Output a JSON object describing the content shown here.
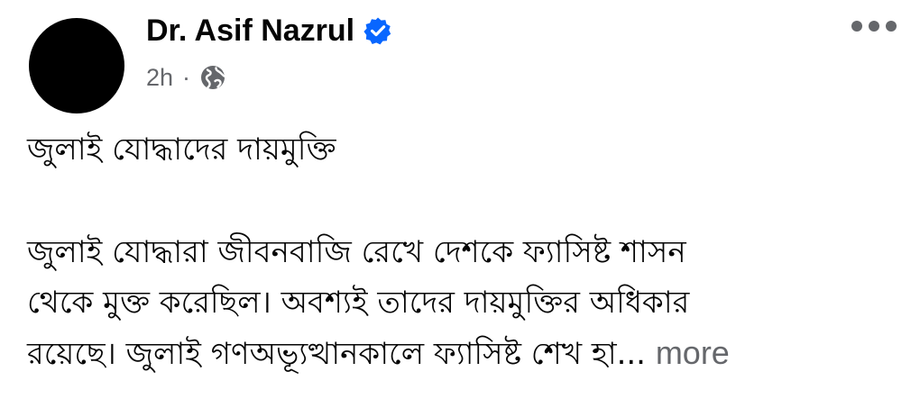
{
  "post": {
    "author_name": "Dr. Asif Nazrul",
    "verified": true,
    "timestamp": "2h",
    "separator": "·",
    "audience_icon": "globe-icon",
    "title": "জুলাই যোদ্ধাদের দায়মুক্তি",
    "body_lines": [
      "জুলাই যোদ্ধারা জীবনবাজি রেখে দেশকে ফ্যাসিষ্ট শাসন",
      "থেকে মুক্ত করেছিল। অবশ্যই তাদের দায়মুক্তির অধিকার",
      "রয়েছে। জুলাই গণঅভ্যূত্থানকালে ফ্যাসিষ্ট শেখ হা..."
    ],
    "see_more_label": "more"
  },
  "icons": {
    "more_menu": "more-horizontal-icon",
    "verified": "verified-badge-icon"
  },
  "colors": {
    "text_primary": "#050505",
    "text_secondary": "#65676b",
    "verified_blue": "#0866ff",
    "avatar": "#000000"
  }
}
